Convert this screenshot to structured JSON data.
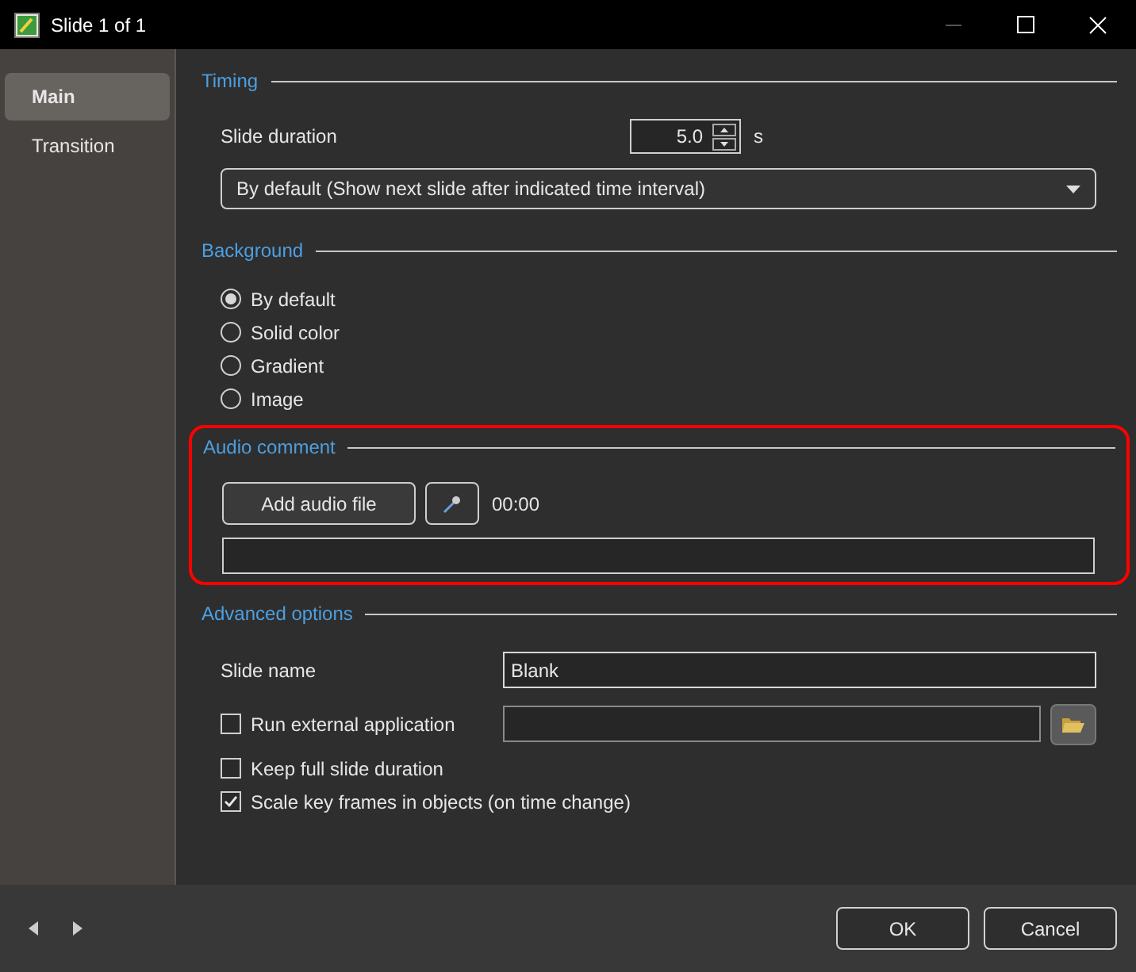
{
  "window": {
    "title": "Slide 1 of 1"
  },
  "sidebar": {
    "items": [
      {
        "label": "Main",
        "selected": true
      },
      {
        "label": "Transition",
        "selected": false
      }
    ]
  },
  "timing": {
    "header": "Timing",
    "duration_label": "Slide duration",
    "duration_value": "5.0",
    "duration_unit": "s",
    "mode": "By default (Show next slide after indicated time interval)"
  },
  "background": {
    "header": "Background",
    "options": [
      {
        "label": "By default",
        "selected": true
      },
      {
        "label": "Solid color",
        "selected": false
      },
      {
        "label": "Gradient",
        "selected": false
      },
      {
        "label": "Image",
        "selected": false
      }
    ]
  },
  "audio_comment": {
    "header": "Audio comment",
    "highlighted": true,
    "add_button": "Add audio file",
    "time": "00:00"
  },
  "advanced": {
    "header": "Advanced options",
    "slide_name_label": "Slide name",
    "slide_name": "Blank",
    "options": [
      {
        "kind": "field",
        "label": "Run external application",
        "checked": false
      },
      {
        "kind": "plain",
        "label": "Keep full slide duration",
        "checked": false
      },
      {
        "kind": "plain",
        "label": "Scale key frames in objects (on time change)",
        "checked": true
      }
    ]
  },
  "buttons": [
    "OK",
    "Cancel"
  ]
}
